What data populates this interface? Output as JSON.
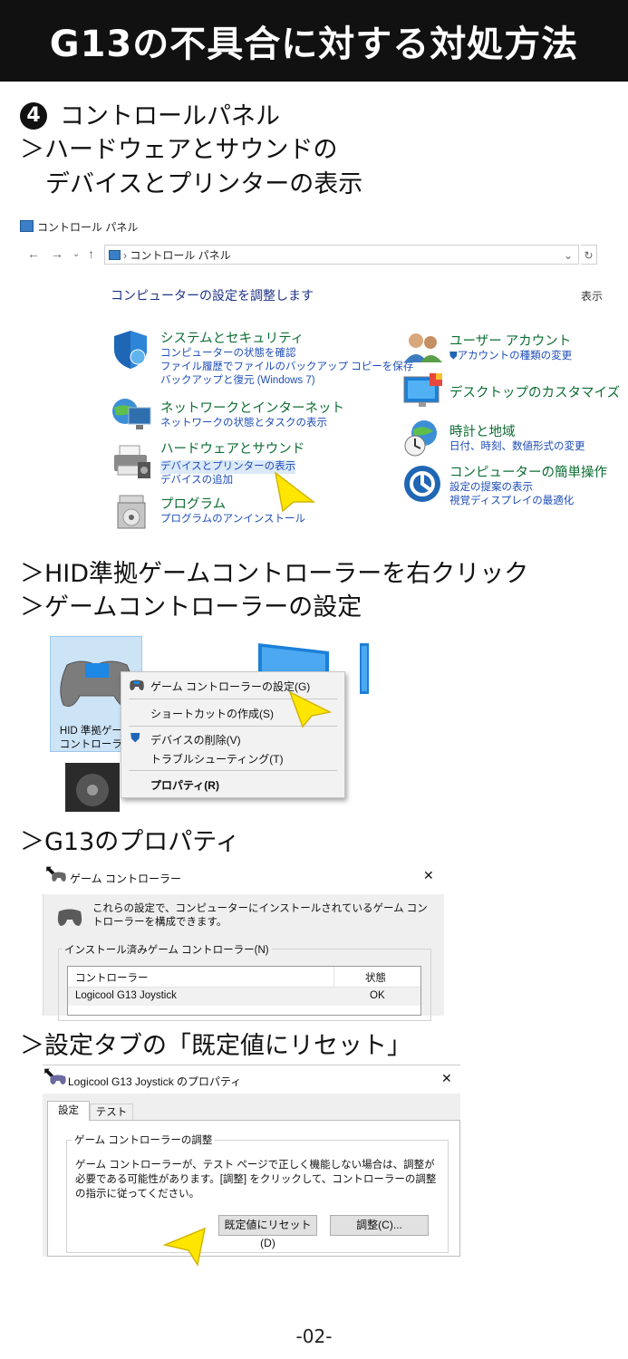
{
  "header": {
    "title": "G13の不具合に対する対処方法"
  },
  "step4": {
    "number": "4",
    "line1": "コントロールパネル",
    "line2": "＞ハードウェアとサウンドの",
    "line3": "デバイスとプリンターの表示"
  },
  "control_panel": {
    "window_title": "コントロール パネル",
    "address": "コントロール パネル",
    "heading": "コンピューターの設定を調整します",
    "view_by": "表示",
    "categories_left": [
      {
        "title": "システムとセキュリティ",
        "links": [
          "コンピューターの状態を確認",
          "ファイル履歴でファイルのバックアップ コピーを保存",
          "バックアップと復元 (Windows 7)"
        ]
      },
      {
        "title": "ネットワークとインターネット",
        "links": [
          "ネットワークの状態とタスクの表示"
        ]
      },
      {
        "title": "ハードウェアとサウンド",
        "links": [
          "デバイスとプリンターの表示",
          "デバイスの追加"
        ]
      },
      {
        "title": "プログラム",
        "links": [
          "プログラムのアンインストール"
        ]
      }
    ],
    "categories_right": [
      {
        "title": "ユーザー アカウント",
        "links": [
          "アカウントの種類の変更"
        ]
      },
      {
        "title": "デスクトップのカスタマイズ",
        "links": []
      },
      {
        "title": "時計と地域",
        "links": [
          "日付、時刻、数値形式の変更"
        ]
      },
      {
        "title": "コンピューターの簡単操作",
        "links": [
          "設定の提案の表示",
          "視覚ディスプレイの最適化"
        ]
      }
    ]
  },
  "step_hid": {
    "line1": "＞HID準拠ゲームコントローラーを右クリック",
    "line2": "＞ゲームコントローラーの設定"
  },
  "device_panel": {
    "device_label_line1": "HID 準拠ゲーム",
    "device_label_line2": "コントローラー",
    "menu_items": [
      "ゲーム コントローラーの設定(G)",
      "ショートカットの作成(S)",
      "デバイスの削除(V)",
      "トラブルシューティング(T)",
      "プロパティ(R)"
    ]
  },
  "step_g13": {
    "line": "＞G13のプロパティ"
  },
  "game_controllers_dialog": {
    "title": "ゲーム コントローラー",
    "close": "✕",
    "description": "これらの設定で、コンピューターにインストールされているゲーム コントローラーを構成できます。",
    "group_label": "インストール済みゲーム コントローラー(N)",
    "columns": [
      "コントローラー",
      "状態"
    ],
    "rows": [
      {
        "name": "Logicool G13 Joystick",
        "status": "OK"
      }
    ]
  },
  "step_reset": {
    "line": "＞設定タブの「既定値にリセット」"
  },
  "properties_dialog": {
    "title": "Logicool G13 Joystick のプロパティ",
    "close": "✕",
    "tabs": [
      "設定",
      "テスト"
    ],
    "group_label": "ゲーム コントローラーの調整",
    "text": "ゲーム コントローラーが、テスト ページで正しく機能しない場合は、調整が必要である可能性があります。[調整] をクリックして、コントローラーの調整の指示に従ってください。",
    "reset_button": "既定値にリセット(D)",
    "calibrate_button": "調整(C)..."
  },
  "footer": {
    "page": "-02-"
  },
  "colors": {
    "header_bg": "#111111",
    "category_title": "#0d6d33",
    "link": "#1e4db7",
    "arrow": "#ffe600"
  }
}
